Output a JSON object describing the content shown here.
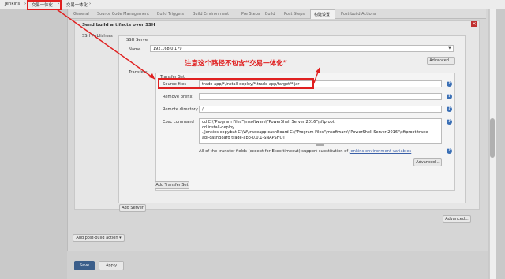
{
  "breadcrumb": {
    "home": "Jenkins",
    "sep1": "›",
    "job": "交易一体化",
    "sep2": "›",
    "job2": "交易一体化",
    "sep3": "›"
  },
  "tabs": [
    "General",
    "Source Code Management",
    "Build Triggers",
    "Build Environment",
    "Pre Steps",
    "Build",
    "Post Steps",
    "构建设置",
    "Post-build Actions"
  ],
  "active_tab_index": 7,
  "section": {
    "title": "Send build artifacts over SSH",
    "publishers_label": "SSH Publishers",
    "ssh_server_label": "SSH Server",
    "name_label": "Name",
    "name_value": "192.168.0.179",
    "advanced_btn": "Advanced...",
    "transfers_label": "Transfers",
    "transfer_set_label": "Transfer Set",
    "source_files_label": "Source files",
    "source_files_value": "trade-app/*,install-deploy/*,trade-app/target/*.jar",
    "remove_prefix_label": "Remove prefix",
    "remove_prefix_value": "",
    "remote_dir_label": "Remote directory",
    "remote_dir_value": "/",
    "exec_label": "Exec command",
    "exec_lines": [
      "cd C:\\\"Program Files\"\\msoftware\\\"PowerShell Server 2016\"\\sftproot",
      "cd install-deploy",
      "./jenkins-copy.bat C:\\W\\tradeapp-cashBoard C:\\\"Program Files\"\\msoftware\\\"PowerShell Server 2016\"\\sftproot trade-",
      "api-cashBoard trade-app-0.0.1-SNAPSHOT"
    ],
    "transfer_note": "All of the transfer fields (except for Exec timeout) support substitution of",
    "transfer_note_link": "Jenkins environment variables",
    "advanced_btn2": "Advanced...",
    "add_transfer_set": "Add Transfer Set",
    "add_server": "Add Server",
    "advanced_btn3": "Advanced..."
  },
  "add_post_build": "Add post-build action",
  "save": "Save",
  "apply": "Apply",
  "annotation": "注意这个路径不包含“交易一体化”",
  "colors": {
    "accent": "#3a6fb5",
    "annotation_red": "#e02020"
  }
}
